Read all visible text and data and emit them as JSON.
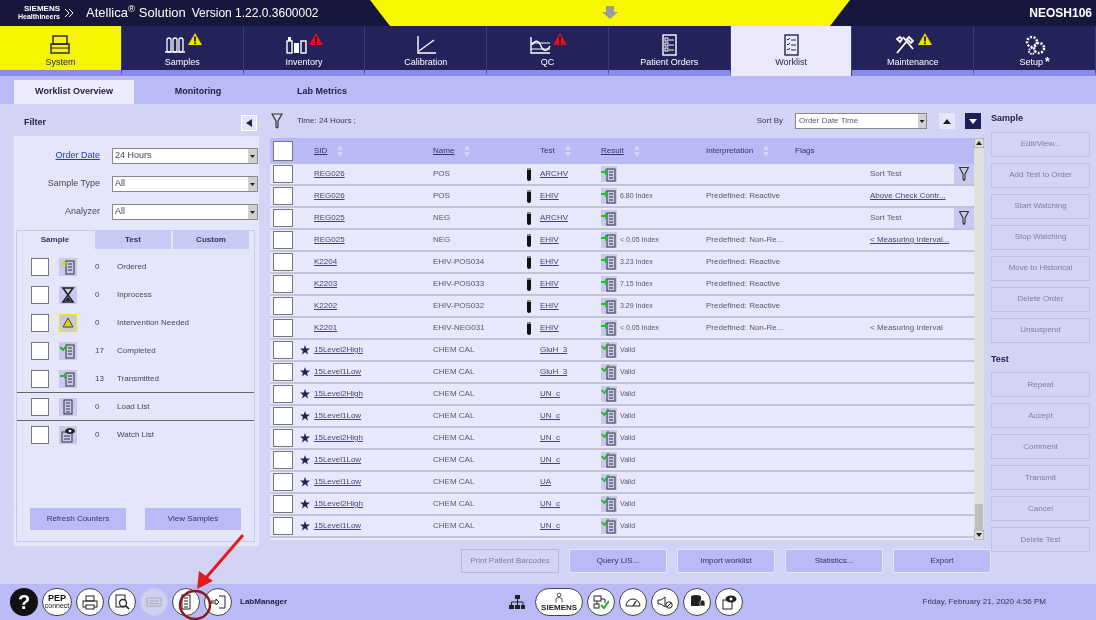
{
  "header": {
    "brand_top": "SIEMENS",
    "brand_bottom": "Healthineers",
    "product": "Atellica$^{®}$ Solution",
    "version": "Version 1.22.0.3600002",
    "host": "NEOSH106"
  },
  "nav": [
    {
      "label": "System",
      "selected": false,
      "highlighted": true
    },
    {
      "label": "Samples",
      "selected": false,
      "highlighted": false,
      "color": "#f2e200"
    },
    {
      "label": "Inventory",
      "selected": false,
      "highlighted": false,
      "color": "#e01020"
    },
    {
      "label": "Calibration",
      "selected": false,
      "highlighted": false
    },
    {
      "label": "QC",
      "selected": false,
      "highlighted": false,
      "color": "#e01020"
    },
    {
      "label": "Patient Orders",
      "selected": false,
      "highlighted": false
    },
    {
      "label": "Worklist",
      "selected": true,
      "highlighted": false
    },
    {
      "label": "Maintenance",
      "selected": false,
      "highlighted": false,
      "color": "#f2e200"
    },
    {
      "label": "Setup",
      "selected": false,
      "highlighted": false,
      "mark": "*"
    }
  ],
  "subtabs": [
    {
      "label": "Worklist Overview",
      "selected": true
    },
    {
      "label": "Monitoring",
      "selected": false
    },
    {
      "label": "Lab Metrics",
      "selected": false
    }
  ],
  "filter": {
    "title": "Filter",
    "fields": [
      {
        "label": "Order Date",
        "link": true,
        "value": "24 Hours"
      },
      {
        "label": "Sample Type",
        "link": false,
        "value": "All"
      },
      {
        "label": "Analyzer",
        "link": false,
        "value": "All"
      }
    ],
    "tabs": [
      {
        "label": "Sample",
        "selected": true
      },
      {
        "label": "Test",
        "selected": false
      },
      {
        "label": "Custom",
        "selected": false
      }
    ],
    "categories": [
      {
        "count": "0",
        "label": "Ordered",
        "checked": false,
        "divider_after": false,
        "alert": false
      },
      {
        "count": "0",
        "label": "Inprocess",
        "checked": false,
        "divider_after": false,
        "alert": false
      },
      {
        "count": "0",
        "label": "Intervention Needed",
        "checked": false,
        "divider_after": false,
        "alert": true
      },
      {
        "count": "17",
        "label": "Completed",
        "checked": false,
        "divider_after": false,
        "alert": false
      },
      {
        "count": "13",
        "label": "Transmitted",
        "checked": false,
        "divider_after": true,
        "alert": false
      },
      {
        "count": "0",
        "label": "Load List",
        "checked": false,
        "divider_after": true,
        "alert": false
      },
      {
        "count": "0",
        "label": "Watch List",
        "checked": false,
        "divider_after": false,
        "alert": false
      }
    ],
    "buttons": [
      "Refresh Counters",
      "View Samples"
    ]
  },
  "toolbar": {
    "filter_text": "Time: 24 Hours ;",
    "sort_label": "Sort By",
    "sort_value": "Order Date Time",
    "ascending_selected": false,
    "descending_selected": true
  },
  "table": {
    "all_checked": false,
    "columns": [
      {
        "label": "SID",
        "sortable": true,
        "underlined": true
      },
      {
        "label": "Name",
        "sortable": true,
        "underlined": true
      },
      {
        "label": "Test",
        "sortable": true,
        "underlined": false
      },
      {
        "label": "Result",
        "sortable": true,
        "underlined": true
      },
      {
        "label": "Interpretation",
        "sortable": true,
        "underlined": false
      },
      {
        "label": "Flags",
        "sortable": false,
        "underlined": false
      }
    ],
    "rows": [
      {
        "checked": false,
        "starred": false,
        "sid": "REG026",
        "name": "POS",
        "tube": true,
        "test": "ARCHV",
        "kind": "transmitted",
        "flags": "Sort Test",
        "flags_link": false,
        "flag_filter": true
      },
      {
        "checked": false,
        "starred": false,
        "sid": "REG026",
        "name": "POS",
        "tube": true,
        "test": "EHIV",
        "kind": "transmitted",
        "result": "6.80 Index",
        "interpretation": "Predefined: Reactive",
        "flags": "Above Check Contr...",
        "flags_link": true,
        "flag_filter": false
      },
      {
        "checked": false,
        "starred": false,
        "sid": "REG025",
        "name": "NEG",
        "tube": true,
        "test": "ARCHV",
        "kind": "transmitted",
        "flags": "Sort Test",
        "flags_link": false,
        "flag_filter": true
      },
      {
        "checked": false,
        "starred": false,
        "sid": "REG025",
        "name": "NEG",
        "tube": true,
        "test": "EHIV",
        "kind": "transmitted",
        "result": "< 0.05 Index",
        "interpretation": "Predefined: Non-Re...",
        "flags": "< Measuring Interval...",
        "flags_link": true,
        "flag_filter": false
      },
      {
        "checked": false,
        "starred": false,
        "sid": "K2204",
        "name": "EHIV-POS034",
        "tube": true,
        "test": "EHIV",
        "kind": "transmitted",
        "result": "3.23 Index",
        "interpretation": "Predefined: Reactive",
        "flag_filter": false
      },
      {
        "checked": false,
        "starred": false,
        "sid": "K2203",
        "name": "EHIV-POS033",
        "tube": true,
        "test": "EHIV",
        "kind": "transmitted",
        "result": "7.15 Index",
        "interpretation": "Predefined: Reactive",
        "flag_filter": false
      },
      {
        "checked": false,
        "starred": false,
        "sid": "K2202",
        "name": "EHIV-POS032",
        "tube": true,
        "test": "EHIV",
        "kind": "transmitted",
        "result": "3.29 Index",
        "interpretation": "Predefined: Reactive",
        "flag_filter": false
      },
      {
        "checked": false,
        "starred": false,
        "sid": "K2201",
        "name": "EHIV-NEG031",
        "tube": true,
        "test": "EHIV",
        "kind": "transmitted",
        "result": "< 0.05 Index",
        "interpretation": "Predefined: Non-Re...",
        "flags": "< Measuring Interval",
        "flags_link": false,
        "flag_filter": false
      },
      {
        "checked": false,
        "starred": true,
        "sid": "15Level2High",
        "name": "CHEM CAL",
        "tube": false,
        "test": "GluH_3",
        "kind": "valid",
        "result": "Valid",
        "flag_filter": false
      },
      {
        "checked": false,
        "starred": true,
        "sid": "15Level1Low",
        "name": "CHEM CAL",
        "tube": false,
        "test": "GluH_3",
        "kind": "valid",
        "result": "Valid",
        "flag_filter": false
      },
      {
        "checked": false,
        "starred": true,
        "sid": "15Level2High",
        "name": "CHEM CAL",
        "tube": false,
        "test": "UN_c",
        "kind": "valid",
        "result": "Valid",
        "flag_filter": false
      },
      {
        "checked": false,
        "starred": true,
        "sid": "15Level1Low",
        "name": "CHEM CAL",
        "tube": false,
        "test": "UN_c",
        "kind": "valid",
        "result": "Valid",
        "flag_filter": false
      },
      {
        "checked": false,
        "starred": true,
        "sid": "15Level2High",
        "name": "CHEM CAL",
        "tube": false,
        "test": "UN_c",
        "kind": "valid",
        "result": "Valid",
        "flag_filter": false
      },
      {
        "checked": false,
        "starred": true,
        "sid": "15Level1Low",
        "name": "CHEM CAL",
        "tube": false,
        "test": "UN_c",
        "kind": "valid",
        "result": "Valid",
        "flag_filter": false
      },
      {
        "checked": false,
        "starred": true,
        "sid": "15Level1Low",
        "name": "CHEM CAL",
        "tube": false,
        "test": "UA",
        "kind": "valid",
        "result": "Valid",
        "flag_filter": false
      },
      {
        "checked": false,
        "starred": true,
        "sid": "15Level2High",
        "name": "CHEM CAL",
        "tube": false,
        "test": "UN_c",
        "kind": "valid",
        "result": "Valid",
        "flag_filter": false
      },
      {
        "checked": false,
        "starred": true,
        "sid": "15Level1Low",
        "name": "CHEM CAL",
        "tube": false,
        "test": "UN_c",
        "kind": "valid",
        "result": "Valid",
        "flag_filter": false
      }
    ]
  },
  "actions": {
    "sample_title": "Sample",
    "sample_buttons": [
      {
        "label": "Edit/View...",
        "disabled": true
      },
      {
        "label": "Add Test to Order",
        "disabled": true
      },
      {
        "label": "Start Watching",
        "disabled": true
      },
      {
        "label": "Stop Watching",
        "disabled": true
      },
      {
        "label": "Move to Historical",
        "disabled": true
      },
      {
        "label": "Delete Order",
        "disabled": true
      },
      {
        "label": "Unsuspend",
        "disabled": true
      }
    ],
    "test_title": "Test",
    "test_buttons": [
      {
        "label": "Repeat",
        "disabled": true
      },
      {
        "label": "Accept",
        "disabled": true
      },
      {
        "label": "Comment",
        "disabled": true
      },
      {
        "label": "Transmit",
        "disabled": true
      },
      {
        "label": "Cancel",
        "disabled": true
      },
      {
        "label": "Delete Test",
        "disabled": true
      }
    ]
  },
  "bottom_buttons": [
    {
      "label": "Print Patient Barcodes",
      "disabled": true
    },
    {
      "label": "Query LIS...",
      "disabled": false
    },
    {
      "label": "Import worklist",
      "disabled": false
    },
    {
      "label": "Statistics...",
      "disabled": false
    },
    {
      "label": "Export",
      "disabled": false
    }
  ],
  "status_bar": {
    "left_buttons": [
      {
        "kind": "help",
        "text": "?",
        "disabled": false
      },
      {
        "kind": "pep",
        "text": "PEP",
        "subtext": "connect",
        "disabled": false
      },
      {
        "kind": "printer",
        "disabled": false
      },
      {
        "kind": "search",
        "disabled": false
      },
      {
        "kind": "keyboard",
        "disabled": true
      },
      {
        "kind": "loadlist",
        "disabled": false
      },
      {
        "kind": "exit",
        "disabled": false
      }
    ],
    "user": "LabManager",
    "center_buttons": [
      {
        "kind": "network"
      },
      {
        "kind": "phone",
        "subtext": "SIEMENS"
      },
      {
        "kind": "netcheck"
      },
      {
        "kind": "gauge"
      },
      {
        "kind": "mute"
      },
      {
        "kind": "database"
      },
      {
        "kind": "watch"
      }
    ],
    "datetime": "Friday, February 21, 2020 4:56 PM"
  }
}
